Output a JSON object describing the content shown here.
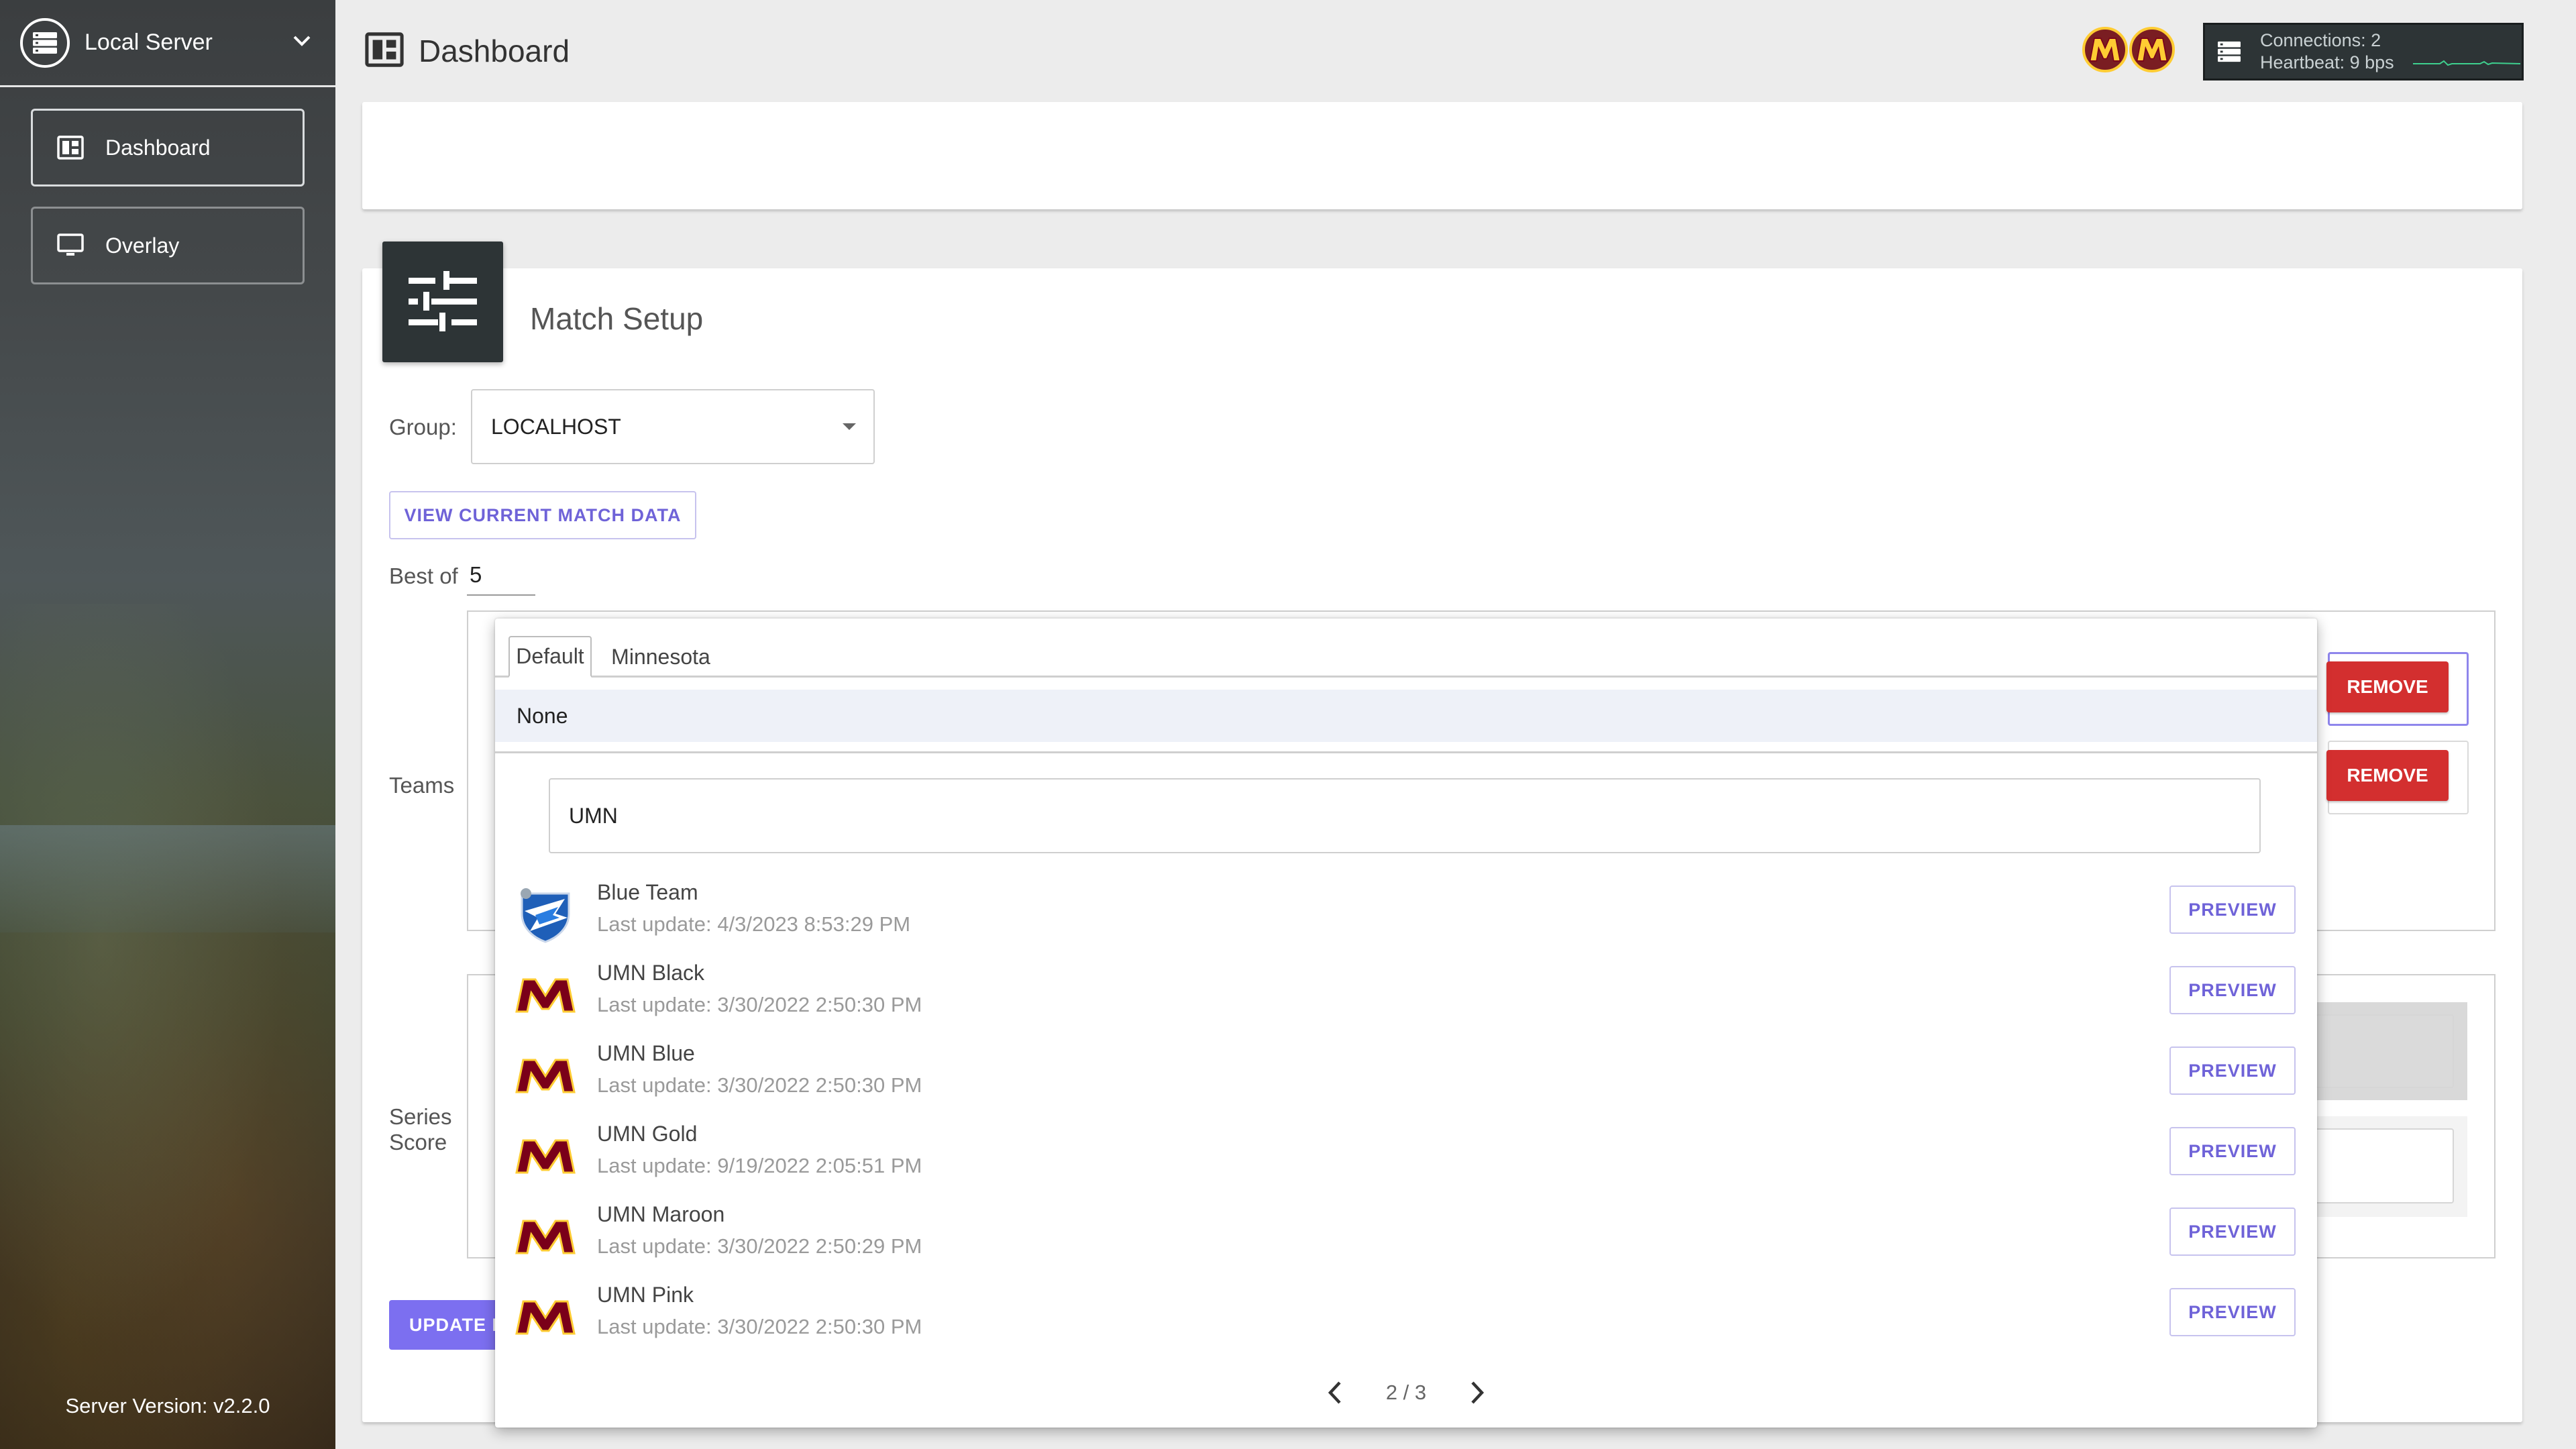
{
  "sidebar": {
    "server_label": "Local Server",
    "items": [
      {
        "label": "Dashboard",
        "active": true
      },
      {
        "label": "Overlay",
        "active": false
      }
    ],
    "version": "Server Version: v2.2.0"
  },
  "header": {
    "title": "Dashboard",
    "connections": "Connections: 2",
    "heartbeat": "Heartbeat: 9 bps"
  },
  "match_setup": {
    "title": "Match Setup",
    "group_label": "Group:",
    "group_value": "LOCALHOST",
    "view_button": "VIEW CURRENT MATCH DATA",
    "best_of_label": "Best of",
    "best_of_value": "5",
    "teams_label": "Teams",
    "remove_label": "REMOVE",
    "series_label_line1": "Series",
    "series_label_line2": "Score",
    "update_button": "UPDATE M"
  },
  "popup": {
    "tabs": [
      "Default",
      "Minnesota"
    ],
    "active_tab": 0,
    "none_label": "None",
    "search_value": "UMN",
    "preview_label": "PREVIEW",
    "items": [
      {
        "name": "Blue Team",
        "updated": "Last update: 4/3/2023 8:53:29 PM",
        "logo": "rocket-league-logo"
      },
      {
        "name": "UMN Black",
        "updated": "Last update: 3/30/2022 2:50:30 PM",
        "logo": "umn-m-logo"
      },
      {
        "name": "UMN Blue",
        "updated": "Last update: 3/30/2022 2:50:30 PM",
        "logo": "umn-m-logo"
      },
      {
        "name": "UMN Gold",
        "updated": "Last update: 9/19/2022 2:05:51 PM",
        "logo": "umn-m-logo"
      },
      {
        "name": "UMN Maroon",
        "updated": "Last update: 3/30/2022 2:50:29 PM",
        "logo": "umn-m-logo"
      },
      {
        "name": "UMN Pink",
        "updated": "Last update: 3/30/2022 2:50:30 PM",
        "logo": "umn-m-logo"
      }
    ],
    "page": "2 / 3"
  },
  "colors": {
    "accent": "#7c6ff0",
    "danger": "#d32f2f",
    "dark": "#2d3436",
    "umn_maroon": "#7a0019",
    "umn_gold": "#ffcc33"
  }
}
